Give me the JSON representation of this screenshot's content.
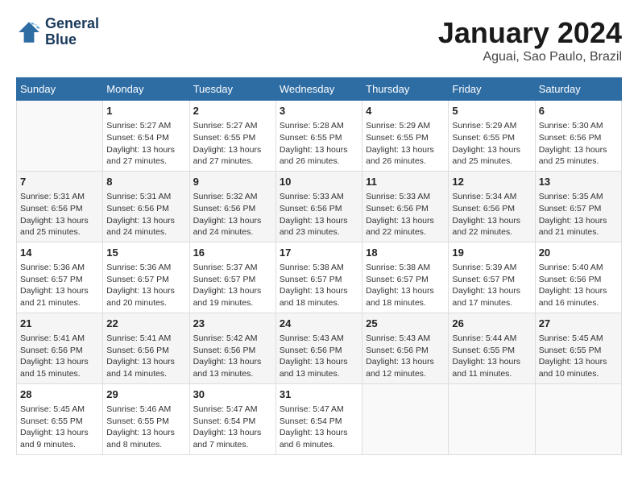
{
  "header": {
    "logo_line1": "General",
    "logo_line2": "Blue",
    "month_year": "January 2024",
    "location": "Aguai, Sao Paulo, Brazil"
  },
  "days_of_week": [
    "Sunday",
    "Monday",
    "Tuesday",
    "Wednesday",
    "Thursday",
    "Friday",
    "Saturday"
  ],
  "weeks": [
    [
      {
        "day": "",
        "content": ""
      },
      {
        "day": "1",
        "content": "Sunrise: 5:27 AM\nSunset: 6:54 PM\nDaylight: 13 hours\nand 27 minutes."
      },
      {
        "day": "2",
        "content": "Sunrise: 5:27 AM\nSunset: 6:55 PM\nDaylight: 13 hours\nand 27 minutes."
      },
      {
        "day": "3",
        "content": "Sunrise: 5:28 AM\nSunset: 6:55 PM\nDaylight: 13 hours\nand 26 minutes."
      },
      {
        "day": "4",
        "content": "Sunrise: 5:29 AM\nSunset: 6:55 PM\nDaylight: 13 hours\nand 26 minutes."
      },
      {
        "day": "5",
        "content": "Sunrise: 5:29 AM\nSunset: 6:55 PM\nDaylight: 13 hours\nand 25 minutes."
      },
      {
        "day": "6",
        "content": "Sunrise: 5:30 AM\nSunset: 6:56 PM\nDaylight: 13 hours\nand 25 minutes."
      }
    ],
    [
      {
        "day": "7",
        "content": "Sunrise: 5:31 AM\nSunset: 6:56 PM\nDaylight: 13 hours\nand 25 minutes."
      },
      {
        "day": "8",
        "content": "Sunrise: 5:31 AM\nSunset: 6:56 PM\nDaylight: 13 hours\nand 24 minutes."
      },
      {
        "day": "9",
        "content": "Sunrise: 5:32 AM\nSunset: 6:56 PM\nDaylight: 13 hours\nand 24 minutes."
      },
      {
        "day": "10",
        "content": "Sunrise: 5:33 AM\nSunset: 6:56 PM\nDaylight: 13 hours\nand 23 minutes."
      },
      {
        "day": "11",
        "content": "Sunrise: 5:33 AM\nSunset: 6:56 PM\nDaylight: 13 hours\nand 22 minutes."
      },
      {
        "day": "12",
        "content": "Sunrise: 5:34 AM\nSunset: 6:56 PM\nDaylight: 13 hours\nand 22 minutes."
      },
      {
        "day": "13",
        "content": "Sunrise: 5:35 AM\nSunset: 6:57 PM\nDaylight: 13 hours\nand 21 minutes."
      }
    ],
    [
      {
        "day": "14",
        "content": "Sunrise: 5:36 AM\nSunset: 6:57 PM\nDaylight: 13 hours\nand 21 minutes."
      },
      {
        "day": "15",
        "content": "Sunrise: 5:36 AM\nSunset: 6:57 PM\nDaylight: 13 hours\nand 20 minutes."
      },
      {
        "day": "16",
        "content": "Sunrise: 5:37 AM\nSunset: 6:57 PM\nDaylight: 13 hours\nand 19 minutes."
      },
      {
        "day": "17",
        "content": "Sunrise: 5:38 AM\nSunset: 6:57 PM\nDaylight: 13 hours\nand 18 minutes."
      },
      {
        "day": "18",
        "content": "Sunrise: 5:38 AM\nSunset: 6:57 PM\nDaylight: 13 hours\nand 18 minutes."
      },
      {
        "day": "19",
        "content": "Sunrise: 5:39 AM\nSunset: 6:57 PM\nDaylight: 13 hours\nand 17 minutes."
      },
      {
        "day": "20",
        "content": "Sunrise: 5:40 AM\nSunset: 6:56 PM\nDaylight: 13 hours\nand 16 minutes."
      }
    ],
    [
      {
        "day": "21",
        "content": "Sunrise: 5:41 AM\nSunset: 6:56 PM\nDaylight: 13 hours\nand 15 minutes."
      },
      {
        "day": "22",
        "content": "Sunrise: 5:41 AM\nSunset: 6:56 PM\nDaylight: 13 hours\nand 14 minutes."
      },
      {
        "day": "23",
        "content": "Sunrise: 5:42 AM\nSunset: 6:56 PM\nDaylight: 13 hours\nand 13 minutes."
      },
      {
        "day": "24",
        "content": "Sunrise: 5:43 AM\nSunset: 6:56 PM\nDaylight: 13 hours\nand 13 minutes."
      },
      {
        "day": "25",
        "content": "Sunrise: 5:43 AM\nSunset: 6:56 PM\nDaylight: 13 hours\nand 12 minutes."
      },
      {
        "day": "26",
        "content": "Sunrise: 5:44 AM\nSunset: 6:55 PM\nDaylight: 13 hours\nand 11 minutes."
      },
      {
        "day": "27",
        "content": "Sunrise: 5:45 AM\nSunset: 6:55 PM\nDaylight: 13 hours\nand 10 minutes."
      }
    ],
    [
      {
        "day": "28",
        "content": "Sunrise: 5:45 AM\nSunset: 6:55 PM\nDaylight: 13 hours\nand 9 minutes."
      },
      {
        "day": "29",
        "content": "Sunrise: 5:46 AM\nSunset: 6:55 PM\nDaylight: 13 hours\nand 8 minutes."
      },
      {
        "day": "30",
        "content": "Sunrise: 5:47 AM\nSunset: 6:54 PM\nDaylight: 13 hours\nand 7 minutes."
      },
      {
        "day": "31",
        "content": "Sunrise: 5:47 AM\nSunset: 6:54 PM\nDaylight: 13 hours\nand 6 minutes."
      },
      {
        "day": "",
        "content": ""
      },
      {
        "day": "",
        "content": ""
      },
      {
        "day": "",
        "content": ""
      }
    ]
  ]
}
